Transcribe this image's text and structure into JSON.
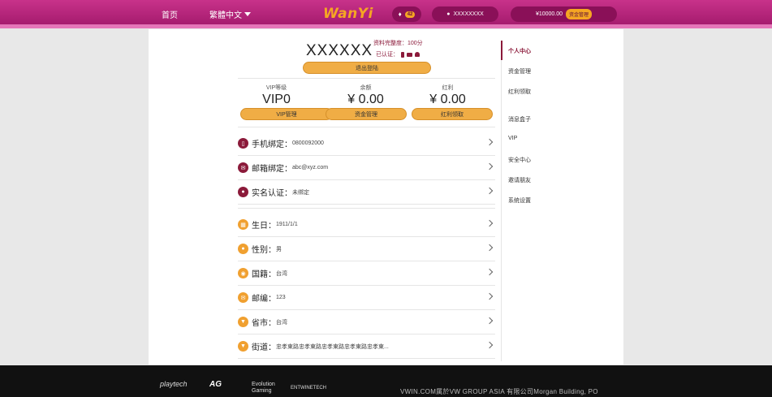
{
  "header": {
    "home": "首页",
    "language": "繁體中文",
    "logo": "WanYi",
    "notification_count": "42",
    "username": "XXXXXXXX",
    "balance": "¥10000.00",
    "fund_button": "资金管理"
  },
  "profile": {
    "username": "XXXXXX",
    "completion": "资料完整度：100分",
    "verified_label": "已认证：",
    "logout": "退出登陆"
  },
  "stats": [
    {
      "label": "VIP等级",
      "value": "VIP0",
      "button": "VIP管理"
    },
    {
      "label": "余额",
      "value": "¥ 0.00",
      "button": "资金管理"
    },
    {
      "label": "红利",
      "value": "¥ 0.00",
      "button": "红利领取"
    }
  ],
  "rows": [
    {
      "label": "手机绑定：",
      "value": "0800092000",
      "icon": "phone-icon"
    },
    {
      "label": "邮箱绑定：",
      "value": "abc@xyz.com",
      "icon": "mail-icon"
    },
    {
      "label": "实名认证：",
      "value": "未绑定",
      "icon": "user-icon"
    },
    {
      "label": "生日：",
      "value": "1911/1/1",
      "icon": "grid-icon"
    },
    {
      "label": "性别：",
      "value": "男",
      "icon": "gender-icon"
    },
    {
      "label": "国籍：",
      "value": "台湾",
      "icon": "globe-icon"
    },
    {
      "label": "邮编：",
      "value": "123",
      "icon": "postal-icon"
    },
    {
      "label": "省市：",
      "value": "台湾",
      "icon": "location-icon"
    },
    {
      "label": "街道：",
      "value": "忠孝東路忠孝東路忠孝東路忠孝東路忠孝東...",
      "icon": "location-icon"
    }
  ],
  "sidebar": [
    "个人中心",
    "资金管理",
    "红利领取",
    "消息盒子",
    "VIP",
    "安全中心",
    "邀请朋友",
    "系统设置"
  ],
  "footer": {
    "brands": [
      "playtech",
      "AG",
      "Evolution Gaming",
      "ENTWINETECH"
    ],
    "copyright": "VWIN.COM属於VW GROUP ASIA 有限公司Morgan Building, PO"
  },
  "colors": {
    "brand_pink": "#b0237a",
    "accent_orange": "#f0ad45",
    "maroon": "#8b1a3a"
  }
}
